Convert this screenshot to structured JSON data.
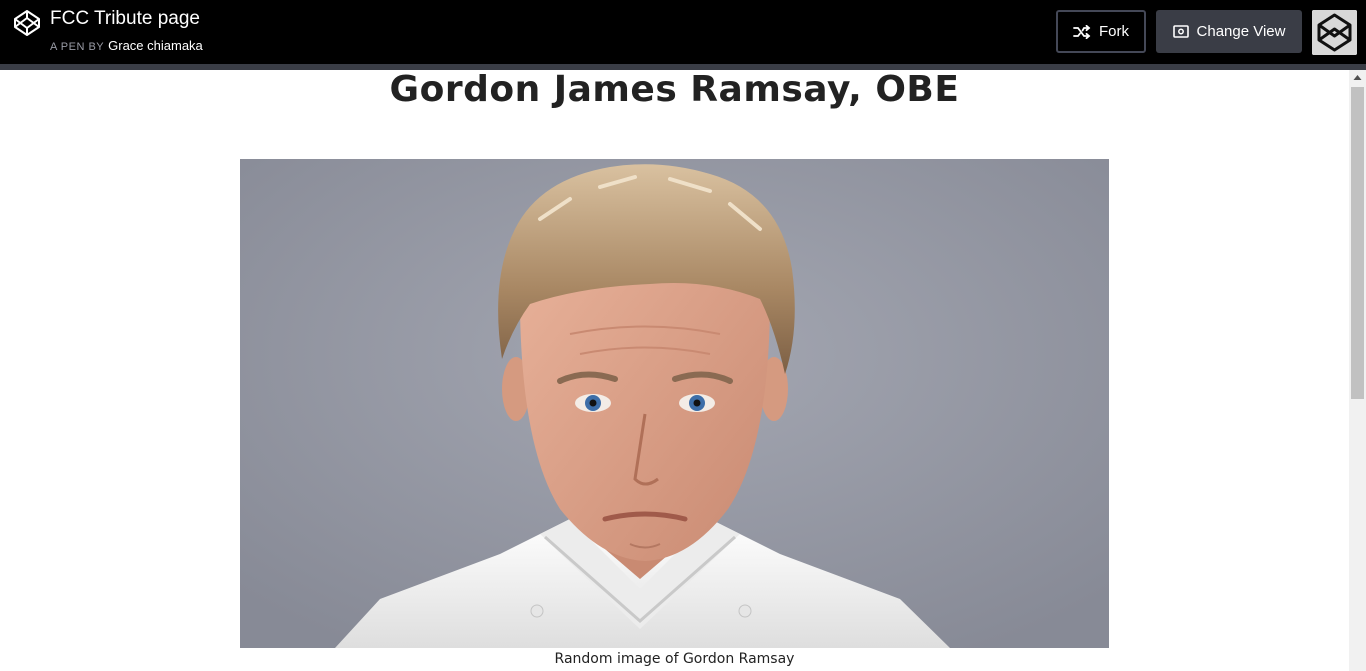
{
  "header": {
    "pen_title": "FCC Tribute page",
    "pen_by_prefix": "A PEN BY",
    "author": "Grace chiamaka",
    "fork_label": "Fork",
    "change_view_label": "Change View"
  },
  "content": {
    "title": "Gordon James Ramsay, OBE",
    "caption": "Random image of Gordon Ramsay"
  },
  "colors": {
    "topbar": "#000000",
    "button_dark": "#3a3d46",
    "photo_background": "#8f93a0",
    "chef_jacket": "#f4f4f2"
  }
}
